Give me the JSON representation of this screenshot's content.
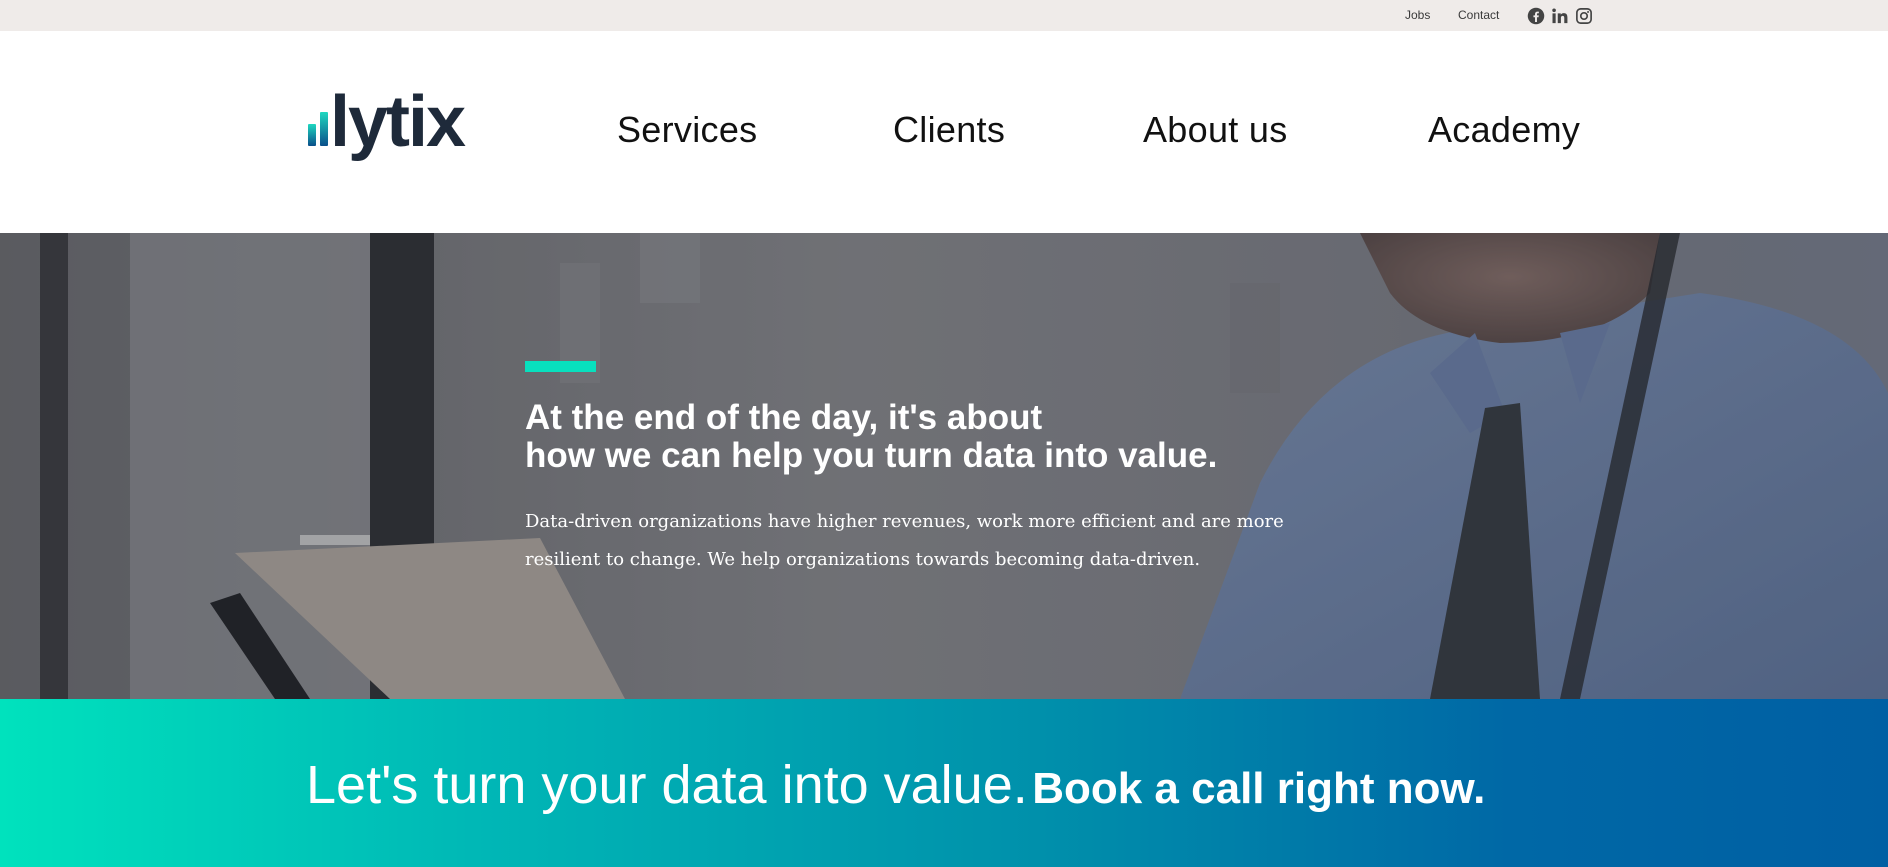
{
  "topbar": {
    "links": [
      {
        "label": "Jobs"
      },
      {
        "label": "Contact"
      }
    ],
    "social": [
      "facebook-icon",
      "linkedin-icon",
      "instagram-icon"
    ]
  },
  "header": {
    "logo_text": "lytix",
    "nav": [
      {
        "label": "Services"
      },
      {
        "label": "Clients"
      },
      {
        "label": "About us"
      },
      {
        "label": "Academy"
      }
    ]
  },
  "hero": {
    "headline_line1": "At the end of the day, it's about",
    "headline_line2": "how we can help you turn data into value.",
    "body": "Data-driven organizations have higher revenues, work more efficient and are more resilient to change. We help organizations towards becoming data-driven."
  },
  "cta": {
    "light_text": "Let's turn your data into value.",
    "bold_text": "Book a call right now."
  },
  "colors": {
    "accent": "#08e0be",
    "logo_dark": "#1e2a3a",
    "topbar_bg": "#efebe9",
    "cta_start": "#00e2bd",
    "cta_end": "#005fa3"
  }
}
